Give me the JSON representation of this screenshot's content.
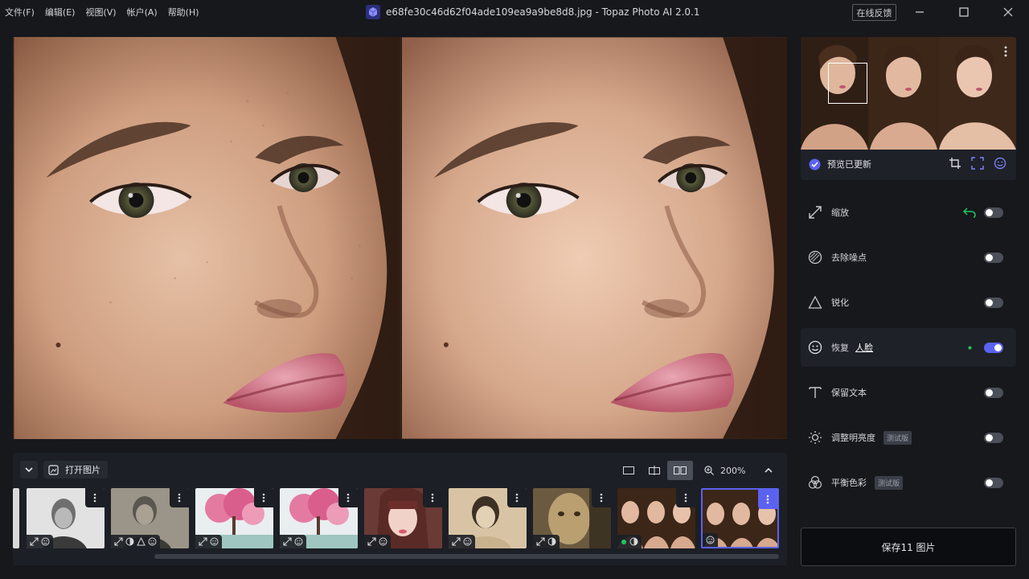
{
  "menu": [
    "文件(F)",
    "编辑(E)",
    "视图(V)",
    "帐户(A)",
    "帮助(H)"
  ],
  "window": {
    "title": "e68fe30c46d62f04ade109ea9a9be8d8.jpg - Topaz Photo AI 2.0.1",
    "feedback_label": "在线反馈"
  },
  "strip": {
    "open_label": "打开图片",
    "zoom_label": "200%",
    "view_mode": "side-by-side",
    "thumbnails": [
      {
        "kind": "bw-portrait",
        "badges": [
          "upscale-icon",
          "face-icon"
        ]
      },
      {
        "kind": "old-portrait",
        "badges": [
          "upscale-icon",
          "denoise-icon",
          "sharpen-icon",
          "face-icon"
        ]
      },
      {
        "kind": "painting",
        "badges": [
          "upscale-icon",
          "face-icon"
        ]
      },
      {
        "kind": "painting",
        "badges": [
          "upscale-icon",
          "face-icon"
        ]
      },
      {
        "kind": "girl-portrait",
        "badges": [
          "upscale-icon",
          "face-icon"
        ]
      },
      {
        "kind": "sepia-portrait",
        "badges": [
          "upscale-icon",
          "face-icon"
        ]
      },
      {
        "kind": "double-exposure",
        "badges": [
          "upscale-icon",
          "denoise-icon"
        ]
      },
      {
        "kind": "model-triptych",
        "badges": [
          "dot",
          "denoise-icon"
        ]
      },
      {
        "kind": "model-triptych",
        "badges": [
          "face-icon"
        ],
        "selected": true
      }
    ]
  },
  "navigator": {
    "status_label": "预览已更新"
  },
  "features": [
    {
      "id": "upscale",
      "label": "缩放",
      "icon": "upscale-icon",
      "enabled": false,
      "has_undo": true
    },
    {
      "id": "denoise",
      "label": "去除噪点",
      "icon": "denoise-icon",
      "enabled": false
    },
    {
      "id": "sharpen",
      "label": "锐化",
      "icon": "sharpen-icon",
      "enabled": false
    },
    {
      "id": "face",
      "label": "恢复",
      "sub_label": "人脸",
      "icon": "face-icon",
      "enabled": true,
      "active": true
    },
    {
      "id": "text",
      "label": "保留文本",
      "icon": "text-icon",
      "enabled": false
    },
    {
      "id": "lighting",
      "label": "调整明亮度",
      "icon": "sun-icon",
      "enabled": false,
      "beta": "测试版"
    },
    {
      "id": "color",
      "label": "平衡色彩",
      "icon": "color-balance-icon",
      "enabled": false,
      "beta": "测试版"
    }
  ],
  "save_label": "保存11 图片",
  "colors": {
    "accent": "#5b62f0",
    "background": "#16181c",
    "panel": "#1e2128"
  }
}
